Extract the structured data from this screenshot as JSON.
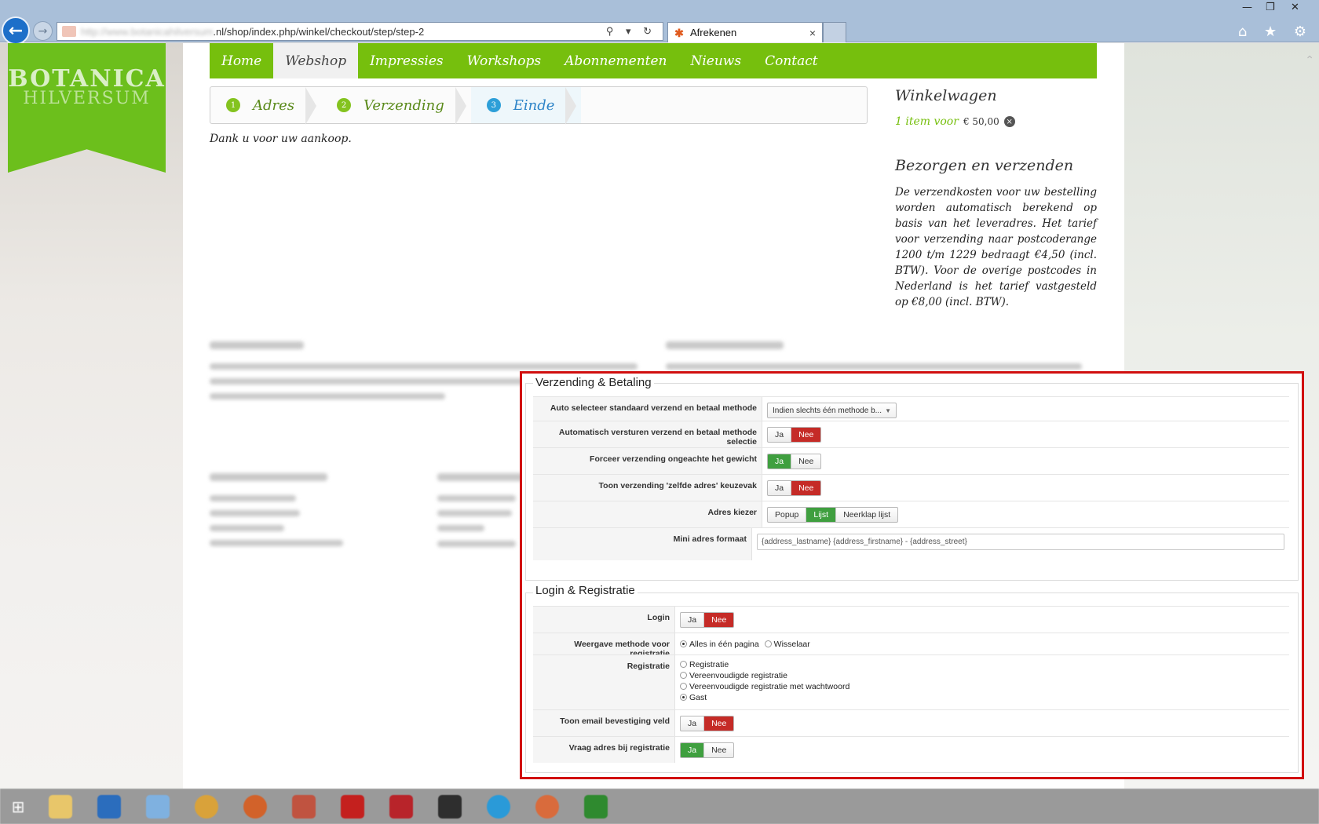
{
  "browser": {
    "url_host": "http://www.botanicahilversum",
    "url_path": ".nl/shop/index.php/winkel/checkout/step/step-2",
    "tab_title": "Afrekenen",
    "tab_close": "×",
    "back_glyph": "←",
    "forward_glyph": "→",
    "addr_tools": "⚲ ▾ ↻",
    "window_controls": [
      "—",
      "❐",
      "✕"
    ],
    "toolbar_icons": [
      "home-icon",
      "favorites-star-icon",
      "settings-gear-icon"
    ],
    "toolbar_glyphs": "⌂ ★ ⚙"
  },
  "logo": {
    "main": "BOTANICA",
    "sub": "HILVERSUM"
  },
  "nav": {
    "items": [
      "Home",
      "Webshop",
      "Impressies",
      "Workshops",
      "Abonnementen",
      "Nieuws",
      "Contact"
    ],
    "active": "Webshop"
  },
  "steps": [
    {
      "num": "1",
      "label": "Adres"
    },
    {
      "num": "2",
      "label": "Verzending"
    },
    {
      "num": "3",
      "label": "Einde"
    }
  ],
  "thanks": "Dank u voor uw aankoop.",
  "cart": {
    "title": "Winkelwagen",
    "items_text": "1 item voor",
    "price": "€ 50,00",
    "remove_glyph": "×"
  },
  "shipping": {
    "title": "Bezorgen en verzenden",
    "text": "De verzendkosten voor uw bestelling worden automatisch berekend op basis van het leveradres. Het tarief voor verzending naar postcoderange 1200 t/m 1229 bedraagt €4,50 (incl. BTW). Voor de overige postcodes in Nederland is het tarief vastgesteld op €8,00 (incl. BTW)."
  },
  "settings": {
    "shipping_payment": {
      "legend": "Verzending & Betaling",
      "auto_select_label": "Auto selecteer standaard verzend en betaal methode",
      "auto_select_value": "Indien slechts één methode b...",
      "auto_submit_label": "Automatisch versturen verzend en betaal methode selectie",
      "force_shipping_label": "Forceer verzending ongeachte het gewicht",
      "same_address_label": "Toon verzending 'zelfde adres' keuzevak",
      "address_picker_label": "Adres kiezer",
      "address_picker_options": [
        "Popup",
        "Lijst",
        "Neerklap lijst"
      ],
      "mini_address_label": "Mini adres formaat",
      "mini_address_value": "{address_lastname} {address_firstname} - {address_street}"
    },
    "login_registration": {
      "legend": "Login & Registratie",
      "login_label": "Login",
      "reg_display_label": "Weergave methode voor registratie",
      "reg_display_options": [
        "Alles in één pagina",
        "Wisselaar"
      ],
      "registration_label": "Registratie",
      "registration_options": [
        "Registratie",
        "Vereenvoudigde registratie",
        "Vereenvoudigde registratie met wachtwoord",
        "Gast"
      ],
      "email_confirm_label": "Toon email bevestiging veld",
      "ask_address_label": "Vraag adres bij registratie"
    },
    "yes": "Ja",
    "no": "Nee"
  },
  "colors": {
    "brand_green": "#76bf0d",
    "toggle_red": "#c52b27",
    "toggle_green": "#3f9f3f",
    "highlight_border": "#d10f0f"
  }
}
